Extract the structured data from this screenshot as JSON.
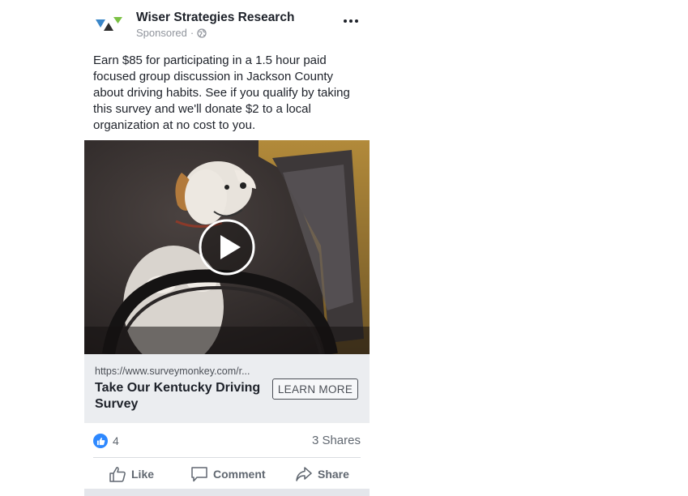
{
  "post": {
    "page_name": "Wiser Strategies Research",
    "sponsored_label": "Sponsored",
    "separator": "·",
    "text": "Earn $85 for participating in a 1.5 hour paid focused group discussion in Jackson County about driving habits. See if you qualify by taking this survey and we'll donate $2 to a local organization at no cost to you.",
    "more_icon": "more-horizontal-icon",
    "privacy_icon": "globe-icon"
  },
  "video": {
    "play_icon": "play-icon"
  },
  "link_preview": {
    "url": "https://www.surveymonkey.com/r...",
    "title": "Take Our Kentucky Driving Survey",
    "cta_label": "LEARN MORE"
  },
  "engagement": {
    "like_count": "4",
    "shares_label": "3 Shares"
  },
  "actions": {
    "like_label": "Like",
    "comment_label": "Comment",
    "share_label": "Share"
  },
  "colors": {
    "like_blue": "#2d88ff",
    "link_box_bg": "#ebedf0",
    "muted_text": "#606770"
  }
}
